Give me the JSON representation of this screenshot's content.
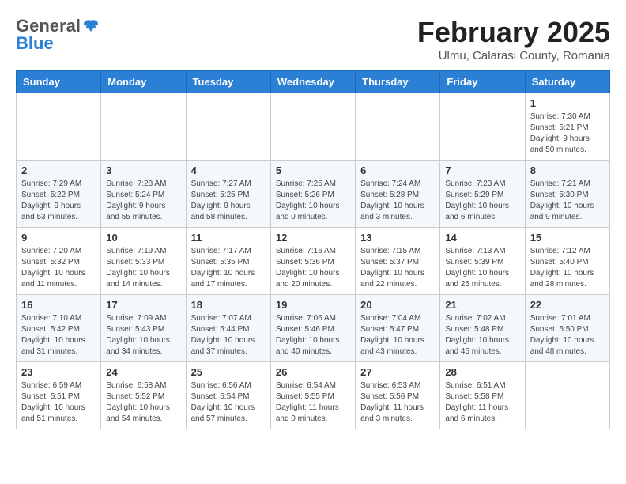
{
  "header": {
    "logo_general": "General",
    "logo_blue": "Blue",
    "month_title": "February 2025",
    "location": "Ulmu, Calarasi County, Romania"
  },
  "weekdays": [
    "Sunday",
    "Monday",
    "Tuesday",
    "Wednesday",
    "Thursday",
    "Friday",
    "Saturday"
  ],
  "weeks": [
    [
      {
        "day": "",
        "info": ""
      },
      {
        "day": "",
        "info": ""
      },
      {
        "day": "",
        "info": ""
      },
      {
        "day": "",
        "info": ""
      },
      {
        "day": "",
        "info": ""
      },
      {
        "day": "",
        "info": ""
      },
      {
        "day": "1",
        "info": "Sunrise: 7:30 AM\nSunset: 5:21 PM\nDaylight: 9 hours and 50 minutes."
      }
    ],
    [
      {
        "day": "2",
        "info": "Sunrise: 7:29 AM\nSunset: 5:22 PM\nDaylight: 9 hours and 53 minutes."
      },
      {
        "day": "3",
        "info": "Sunrise: 7:28 AM\nSunset: 5:24 PM\nDaylight: 9 hours and 55 minutes."
      },
      {
        "day": "4",
        "info": "Sunrise: 7:27 AM\nSunset: 5:25 PM\nDaylight: 9 hours and 58 minutes."
      },
      {
        "day": "5",
        "info": "Sunrise: 7:25 AM\nSunset: 5:26 PM\nDaylight: 10 hours and 0 minutes."
      },
      {
        "day": "6",
        "info": "Sunrise: 7:24 AM\nSunset: 5:28 PM\nDaylight: 10 hours and 3 minutes."
      },
      {
        "day": "7",
        "info": "Sunrise: 7:23 AM\nSunset: 5:29 PM\nDaylight: 10 hours and 6 minutes."
      },
      {
        "day": "8",
        "info": "Sunrise: 7:21 AM\nSunset: 5:30 PM\nDaylight: 10 hours and 9 minutes."
      }
    ],
    [
      {
        "day": "9",
        "info": "Sunrise: 7:20 AM\nSunset: 5:32 PM\nDaylight: 10 hours and 11 minutes."
      },
      {
        "day": "10",
        "info": "Sunrise: 7:19 AM\nSunset: 5:33 PM\nDaylight: 10 hours and 14 minutes."
      },
      {
        "day": "11",
        "info": "Sunrise: 7:17 AM\nSunset: 5:35 PM\nDaylight: 10 hours and 17 minutes."
      },
      {
        "day": "12",
        "info": "Sunrise: 7:16 AM\nSunset: 5:36 PM\nDaylight: 10 hours and 20 minutes."
      },
      {
        "day": "13",
        "info": "Sunrise: 7:15 AM\nSunset: 5:37 PM\nDaylight: 10 hours and 22 minutes."
      },
      {
        "day": "14",
        "info": "Sunrise: 7:13 AM\nSunset: 5:39 PM\nDaylight: 10 hours and 25 minutes."
      },
      {
        "day": "15",
        "info": "Sunrise: 7:12 AM\nSunset: 5:40 PM\nDaylight: 10 hours and 28 minutes."
      }
    ],
    [
      {
        "day": "16",
        "info": "Sunrise: 7:10 AM\nSunset: 5:42 PM\nDaylight: 10 hours and 31 minutes."
      },
      {
        "day": "17",
        "info": "Sunrise: 7:09 AM\nSunset: 5:43 PM\nDaylight: 10 hours and 34 minutes."
      },
      {
        "day": "18",
        "info": "Sunrise: 7:07 AM\nSunset: 5:44 PM\nDaylight: 10 hours and 37 minutes."
      },
      {
        "day": "19",
        "info": "Sunrise: 7:06 AM\nSunset: 5:46 PM\nDaylight: 10 hours and 40 minutes."
      },
      {
        "day": "20",
        "info": "Sunrise: 7:04 AM\nSunset: 5:47 PM\nDaylight: 10 hours and 43 minutes."
      },
      {
        "day": "21",
        "info": "Sunrise: 7:02 AM\nSunset: 5:48 PM\nDaylight: 10 hours and 45 minutes."
      },
      {
        "day": "22",
        "info": "Sunrise: 7:01 AM\nSunset: 5:50 PM\nDaylight: 10 hours and 48 minutes."
      }
    ],
    [
      {
        "day": "23",
        "info": "Sunrise: 6:59 AM\nSunset: 5:51 PM\nDaylight: 10 hours and 51 minutes."
      },
      {
        "day": "24",
        "info": "Sunrise: 6:58 AM\nSunset: 5:52 PM\nDaylight: 10 hours and 54 minutes."
      },
      {
        "day": "25",
        "info": "Sunrise: 6:56 AM\nSunset: 5:54 PM\nDaylight: 10 hours and 57 minutes."
      },
      {
        "day": "26",
        "info": "Sunrise: 6:54 AM\nSunset: 5:55 PM\nDaylight: 11 hours and 0 minutes."
      },
      {
        "day": "27",
        "info": "Sunrise: 6:53 AM\nSunset: 5:56 PM\nDaylight: 11 hours and 3 minutes."
      },
      {
        "day": "28",
        "info": "Sunrise: 6:51 AM\nSunset: 5:58 PM\nDaylight: 11 hours and 6 minutes."
      },
      {
        "day": "",
        "info": ""
      }
    ]
  ]
}
